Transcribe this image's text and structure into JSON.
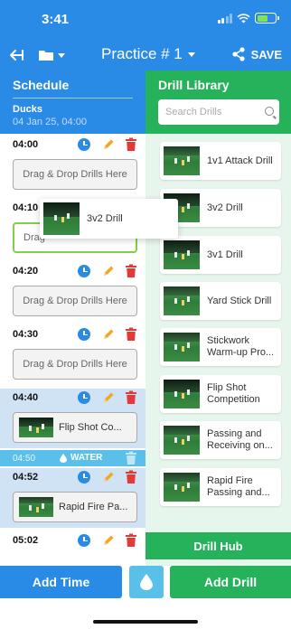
{
  "status": {
    "time": "3:41"
  },
  "nav": {
    "title": "Practice # 1",
    "save_label": "SAVE"
  },
  "schedule": {
    "title": "Schedule",
    "team": "Ducks",
    "date": "04 Jan 25, 04:00",
    "drop_placeholder": "Drag & Drop Drills Here",
    "drop_placeholder_partial": "Drag",
    "slots": [
      {
        "time": "04:00"
      },
      {
        "time": "04:10"
      },
      {
        "time": "04:20"
      },
      {
        "time": "04:30"
      },
      {
        "time": "04:40",
        "drill": "Flip Shot Co..."
      },
      {
        "time": "04:52",
        "drill": "Rapid Fire Pa..."
      },
      {
        "time": "05:02"
      }
    ],
    "water": {
      "time": "04:50",
      "label": "WATER"
    }
  },
  "dragging": {
    "label": "3v2 Drill"
  },
  "library": {
    "title": "Drill Library",
    "search_placeholder": "Search Drills",
    "drills": [
      {
        "line1": "1v1 Attack Drill",
        "line2": ""
      },
      {
        "line1": "3v2 Drill",
        "line2": ""
      },
      {
        "line1": "3v1 Drill",
        "line2": ""
      },
      {
        "line1": "Yard Stick Drill",
        "line2": ""
      },
      {
        "line1": "Stickwork",
        "line2": "Warm-up Pro..."
      },
      {
        "line1": "Flip Shot",
        "line2": "Competition"
      },
      {
        "line1": "Passing and",
        "line2": "Receiving on..."
      },
      {
        "line1": "Rapid Fire",
        "line2": "Passing and..."
      }
    ],
    "hub_label": "Drill Hub"
  },
  "bottom": {
    "add_time": "Add Time",
    "add_drill": "Add Drill"
  },
  "colors": {
    "blue": "#2a8be6",
    "green": "#25b25b",
    "water": "#5ac0ea",
    "red": "#e53935",
    "orange": "#f5a623"
  }
}
